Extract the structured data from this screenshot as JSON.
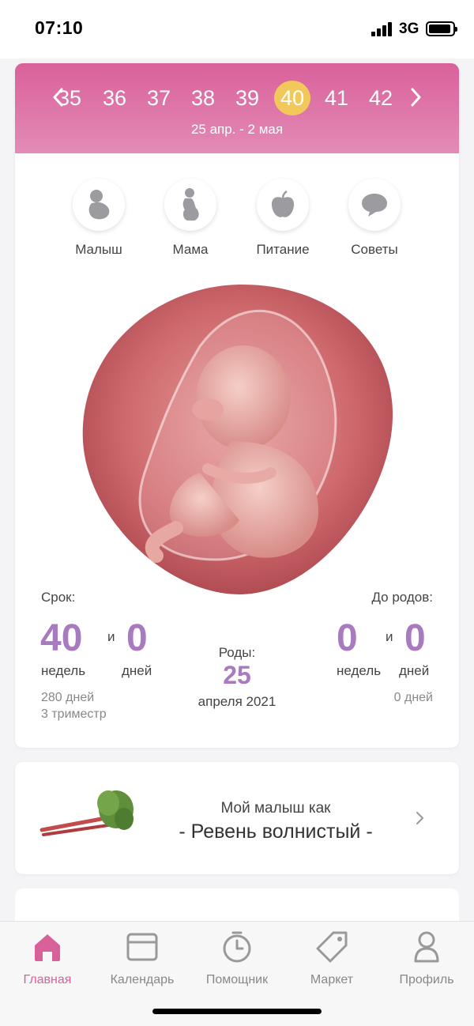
{
  "status_bar": {
    "time": "07:10",
    "network": "3G"
  },
  "week_nav": {
    "weeks": [
      "35",
      "36",
      "37",
      "38",
      "39",
      "40",
      "41",
      "42"
    ],
    "selected": "40",
    "date_range": "25 апр. - 2 мая"
  },
  "categories": [
    {
      "label": "Малыш",
      "icon": "baby-icon"
    },
    {
      "label": "Мама",
      "icon": "pregnant-woman-icon"
    },
    {
      "label": "Питание",
      "icon": "apple-icon"
    },
    {
      "label": "Советы",
      "icon": "speech-bubble-icon"
    }
  ],
  "term": {
    "label": "Срок:",
    "weeks": "40",
    "and": "и",
    "days": "0",
    "weeks_unit": "недель",
    "days_unit": "дней",
    "total_days": "280 дней",
    "trimester": "3 триместр"
  },
  "due": {
    "label": "Роды:",
    "day": "25",
    "month_year": "апреля 2021"
  },
  "until_birth": {
    "label": "До родов:",
    "weeks": "0",
    "and": "и",
    "days": "0",
    "weeks_unit": "недель",
    "days_unit": "дней",
    "total_days": "0 дней"
  },
  "size_card": {
    "subtitle": "Мой малыш как",
    "name": "- Ревень волнистый -",
    "icon": "rhubarb-image"
  },
  "tabs": [
    {
      "label": "Главная",
      "icon": "home-icon",
      "active": true
    },
    {
      "label": "Календарь",
      "icon": "calendar-icon",
      "active": false
    },
    {
      "label": "Помощник",
      "icon": "timer-icon",
      "active": false
    },
    {
      "label": "Маркет",
      "icon": "tag-icon",
      "active": false
    },
    {
      "label": "Профиль",
      "icon": "profile-icon",
      "active": false
    }
  ],
  "colors": {
    "accent": "#d9619a",
    "highlight": "#f3c85a",
    "number": "#a87ac0"
  }
}
